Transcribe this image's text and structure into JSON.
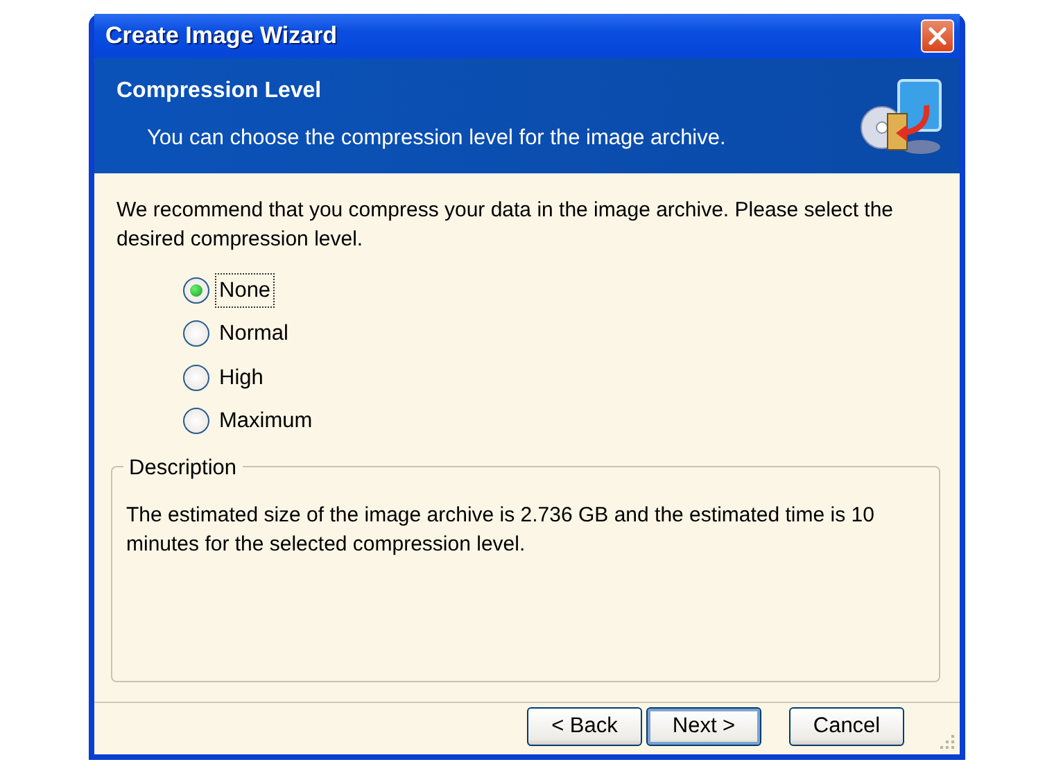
{
  "window": {
    "title": "Create Image Wizard"
  },
  "header": {
    "title": "Compression Level",
    "subtitle": "You can choose the compression level for the image archive."
  },
  "intro": "We recommend that you compress your data in the image archive. Please select the desired compression level.",
  "options": [
    {
      "label": "None",
      "selected": true,
      "focused": true
    },
    {
      "label": "Normal",
      "selected": false,
      "focused": false
    },
    {
      "label": "High",
      "selected": false,
      "focused": false
    },
    {
      "label": "Maximum",
      "selected": false,
      "focused": false
    }
  ],
  "description": {
    "legend": "Description",
    "text": "The estimated size of the image archive is 2.736 GB and the estimated time is 10 minutes for the selected compression level."
  },
  "buttons": [
    {
      "label": "< Back",
      "default": false
    },
    {
      "label": "Next >",
      "default": true
    },
    {
      "label": "Cancel",
      "default": false
    }
  ]
}
